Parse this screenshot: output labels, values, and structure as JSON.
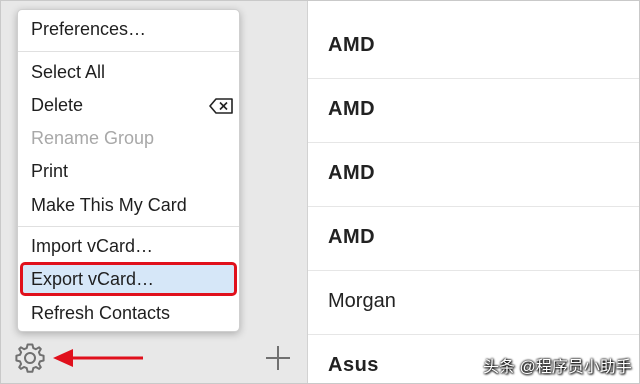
{
  "menu": {
    "items": [
      {
        "label": "Preferences…",
        "disabled": false
      },
      {
        "label": "Select All",
        "disabled": false
      },
      {
        "label": "Delete",
        "disabled": false
      },
      {
        "label": "Rename Group",
        "disabled": true
      },
      {
        "label": "Print",
        "disabled": false
      },
      {
        "label": "Make This My Card",
        "disabled": false
      },
      {
        "label": "Import vCard…",
        "disabled": false
      },
      {
        "label": "Export vCard…",
        "disabled": false,
        "highlighted": true
      },
      {
        "label": "Refresh Contacts",
        "disabled": false
      }
    ]
  },
  "contacts": [
    {
      "name": "AMD",
      "bold": true
    },
    {
      "name": "AMD",
      "bold": true
    },
    {
      "name": "AMD",
      "bold": true
    },
    {
      "name": "AMD",
      "bold": true
    },
    {
      "name": "Morgan",
      "bold": false
    },
    {
      "name": "Asus",
      "bold": true
    }
  ],
  "toolbar": {
    "settings_icon": "gear-icon",
    "add_icon": "plus-icon",
    "annotation_icon": "red-arrow-icon"
  },
  "colors": {
    "highlight_fill": "#d6e7f8",
    "highlight_border": "#e0101c",
    "arrow": "#e0101c"
  },
  "watermark": {
    "text": "头条 @程序员小助手"
  }
}
